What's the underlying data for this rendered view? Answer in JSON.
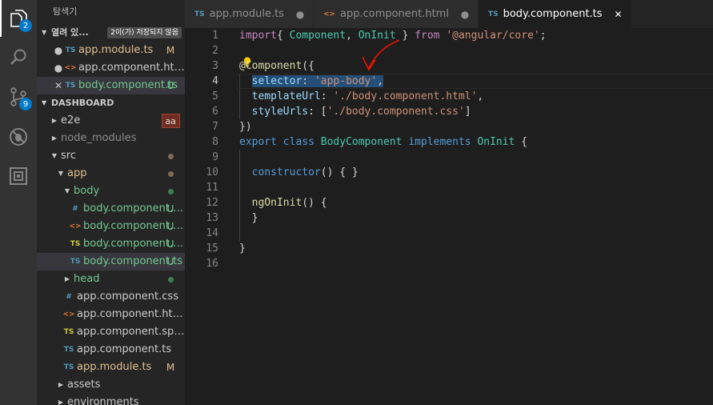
{
  "sidebar": {
    "title": "탐색기",
    "open_editors": {
      "label": "열려 있...",
      "unsaved": "2이(가) 저장되지 않음",
      "items": [
        {
          "mark": "●",
          "icon": "TS",
          "icon_color": "#519aba",
          "name": "app.module.ts",
          "decoration": "M",
          "deco_color": "#e2c08d",
          "label_color": "#e2c08d"
        },
        {
          "mark": "●",
          "icon": "<>",
          "icon_color": "#e37933",
          "name": "app.component.html",
          "decoration": "",
          "deco_color": "",
          "label_color": "#cccccc"
        },
        {
          "mark": "✕",
          "icon": "TS",
          "icon_color": "#519aba",
          "name": "body.component.ts",
          "decoration": "U",
          "deco_color": "#73c991",
          "label_color": "#73c991"
        }
      ]
    },
    "project": {
      "label": "DASHBOARD",
      "tree": [
        {
          "indent": 0,
          "type": "folder",
          "open": false,
          "name": "e2e",
          "color": "#cccccc",
          "badge": "aa"
        },
        {
          "indent": 0,
          "type": "folder",
          "open": false,
          "name": "node_modules",
          "color": "#8c8c8c"
        },
        {
          "indent": 0,
          "type": "folder",
          "open": true,
          "name": "src",
          "color": "#cccccc",
          "dot": "#7d6b56"
        },
        {
          "indent": 1,
          "type": "folder",
          "open": true,
          "name": "app",
          "color": "#e2c08d",
          "dot": "#7d6b56"
        },
        {
          "indent": 2,
          "type": "folder",
          "open": true,
          "name": "body",
          "color": "#73c991",
          "dot": "#3f7d55"
        },
        {
          "indent": 3,
          "type": "file",
          "icon": "#",
          "icon_color": "#519aba",
          "name": "body.component.css",
          "color": "#73c991",
          "decoration": "U"
        },
        {
          "indent": 3,
          "type": "file",
          "icon": "<>",
          "icon_color": "#e37933",
          "name": "body.component.html",
          "color": "#73c991",
          "decoration": "U"
        },
        {
          "indent": 3,
          "type": "file",
          "icon": "TS",
          "icon_color": "#cbcb41",
          "name": "body.component.spec.ts",
          "color": "#73c991",
          "decoration": "U"
        },
        {
          "indent": 3,
          "type": "file",
          "icon": "TS",
          "icon_color": "#519aba",
          "name": "body.component.ts",
          "color": "#73c991",
          "decoration": "U",
          "selected": true
        },
        {
          "indent": 2,
          "type": "folder",
          "open": false,
          "name": "head",
          "color": "#73c991",
          "dot": "#3f7d55"
        },
        {
          "indent": 2,
          "type": "file",
          "icon": "#",
          "icon_color": "#519aba",
          "name": "app.component.css",
          "color": "#cccccc"
        },
        {
          "indent": 2,
          "type": "file",
          "icon": "<>",
          "icon_color": "#e37933",
          "name": "app.component.html",
          "color": "#cccccc"
        },
        {
          "indent": 2,
          "type": "file",
          "icon": "TS",
          "icon_color": "#cbcb41",
          "name": "app.component.spec.ts",
          "color": "#cccccc"
        },
        {
          "indent": 2,
          "type": "file",
          "icon": "TS",
          "icon_color": "#519aba",
          "name": "app.component.ts",
          "color": "#cccccc"
        },
        {
          "indent": 2,
          "type": "file",
          "icon": "TS",
          "icon_color": "#519aba",
          "name": "app.module.ts",
          "color": "#e2c08d",
          "decoration": "M"
        },
        {
          "indent": 1,
          "type": "folder",
          "open": false,
          "name": "assets",
          "color": "#cccccc"
        },
        {
          "indent": 1,
          "type": "folder",
          "open": false,
          "name": "environments",
          "color": "#cccccc"
        }
      ]
    }
  },
  "activity": {
    "explorer_badge": "2",
    "scm_badge": "9"
  },
  "tabs": [
    {
      "icon": "TS",
      "icon_color": "#519aba",
      "label": "app.module.ts",
      "state": "●",
      "active": false
    },
    {
      "icon": "<>",
      "icon_color": "#e37933",
      "label": "app.component.html",
      "state": "●",
      "active": false
    },
    {
      "icon": "TS",
      "icon_color": "#519aba",
      "label": "body.component.ts",
      "state": "✕",
      "active": true
    }
  ],
  "editor": {
    "current_line": 4,
    "lines": [
      [
        [
          "k-ctrl",
          "import"
        ],
        [
          "",
          "{ "
        ],
        [
          "k-type",
          "Component"
        ],
        [
          "",
          ", "
        ],
        [
          "k-type",
          "OnInit"
        ],
        [
          "",
          " } "
        ],
        [
          "k-ctrl",
          "from"
        ],
        [
          "",
          " "
        ],
        [
          "k-str",
          "'@angular/core'"
        ],
        [
          "",
          ";"
        ]
      ],
      [],
      [
        [
          "k-fn",
          "@"
        ],
        [
          "k-fn",
          "Component"
        ],
        [
          "",
          "({"
        ]
      ],
      [
        [
          "",
          "  "
        ],
        [
          "k-prop sel",
          "selector"
        ],
        [
          "sel",
          ": "
        ],
        [
          "k-str sel",
          "'app-body'"
        ],
        [
          "sel",
          ","
        ]
      ],
      [
        [
          "",
          "  "
        ],
        [
          "k-prop",
          "templateUrl"
        ],
        [
          "",
          ": "
        ],
        [
          "k-str",
          "'./body.component.html'"
        ],
        [
          "",
          ","
        ]
      ],
      [
        [
          "",
          "  "
        ],
        [
          "k-prop",
          "styleUrls"
        ],
        [
          "",
          ": ["
        ],
        [
          "k-str",
          "'./body.component.css'"
        ],
        [
          "",
          "]"
        ]
      ],
      [
        [
          "",
          "})"
        ]
      ],
      [
        [
          "k-kw",
          "export"
        ],
        [
          "",
          " "
        ],
        [
          "k-kw",
          "class"
        ],
        [
          "",
          " "
        ],
        [
          "k-type",
          "BodyComponent"
        ],
        [
          "",
          " "
        ],
        [
          "k-kw",
          "implements"
        ],
        [
          "",
          " "
        ],
        [
          "k-type",
          "OnInit"
        ],
        [
          "",
          " {"
        ]
      ],
      [],
      [
        [
          "",
          "  "
        ],
        [
          "k-kw",
          "constructor"
        ],
        [
          "",
          "() { }"
        ]
      ],
      [],
      [
        [
          "",
          "  "
        ],
        [
          "k-fn",
          "ngOnInit"
        ],
        [
          "",
          "() {"
        ]
      ],
      [
        [
          "",
          "  }"
        ]
      ],
      [],
      [
        [
          "",
          "}"
        ]
      ],
      []
    ]
  },
  "colors": {
    "annotation_arrow": "#e51400",
    "lightbulb": "#ffcc00"
  }
}
